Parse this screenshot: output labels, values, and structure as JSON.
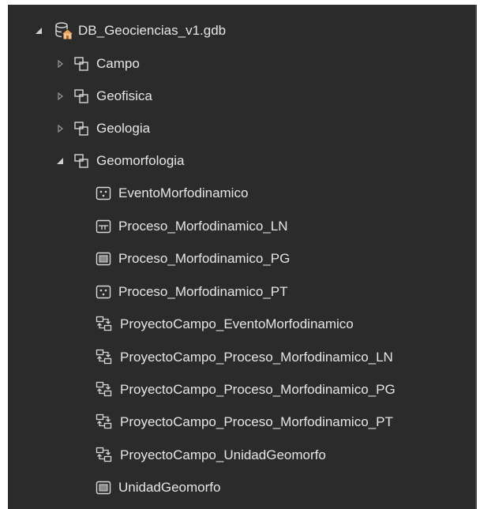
{
  "tree": {
    "root": {
      "label": "DB_Geociencias_v1.gdb",
      "expanded": true,
      "icon": "geodatabase-icon"
    },
    "datasets": [
      {
        "label": "Campo",
        "expanded": false,
        "icon": "feature-dataset-icon"
      },
      {
        "label": "Geofisica",
        "expanded": false,
        "icon": "feature-dataset-icon"
      },
      {
        "label": "Geologia",
        "expanded": false,
        "icon": "feature-dataset-icon"
      },
      {
        "label": "Geomorfologia",
        "expanded": true,
        "icon": "feature-dataset-icon"
      }
    ],
    "children": [
      {
        "label": "EventoMorfodinamico",
        "icon": "point-feature-class-icon"
      },
      {
        "label": "Proceso_Morfodinamico_LN",
        "icon": "line-feature-class-icon"
      },
      {
        "label": "Proceso_Morfodinamico_PG",
        "icon": "polygon-feature-class-icon"
      },
      {
        "label": "Proceso_Morfodinamico_PT",
        "icon": "point-feature-class-icon"
      },
      {
        "label": "ProyectoCampo_EventoMorfodinamico",
        "icon": "relationship-class-icon"
      },
      {
        "label": "ProyectoCampo_Proceso_Morfodinamico_LN",
        "icon": "relationship-class-icon"
      },
      {
        "label": "ProyectoCampo_Proceso_Morfodinamico_PG",
        "icon": "relationship-class-icon"
      },
      {
        "label": "ProyectoCampo_Proceso_Morfodinamico_PT",
        "icon": "relationship-class-icon"
      },
      {
        "label": "ProyectoCampo_UnidadGeomorfo",
        "icon": "relationship-class-icon"
      },
      {
        "label": "UnidadGeomorfo",
        "icon": "polygon-feature-class-icon"
      }
    ]
  }
}
